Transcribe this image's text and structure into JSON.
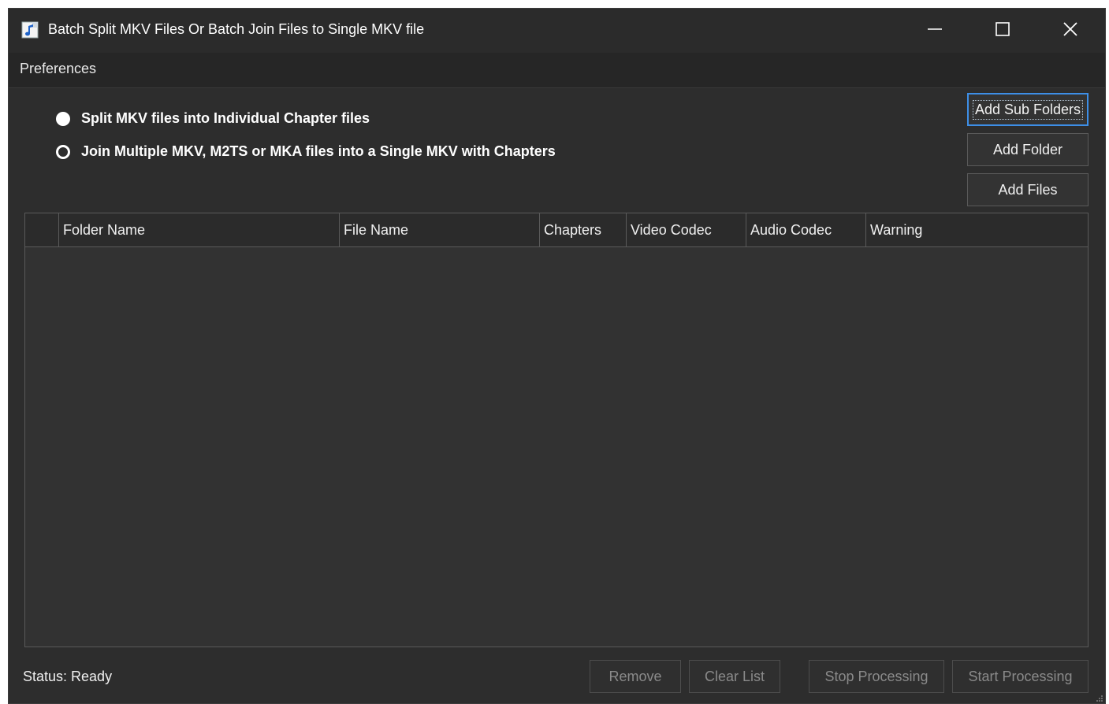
{
  "window": {
    "title": "Batch Split MKV Files Or Batch Join Files to Single MKV file",
    "app_icon": "music-note-icon",
    "controls": {
      "minimize_icon": "minimize-icon",
      "maximize_icon": "maximize-icon",
      "close_icon": "close-icon"
    }
  },
  "menubar": {
    "items": [
      {
        "label": "Preferences"
      }
    ]
  },
  "modes": {
    "split_label": "Split MKV files into Individual Chapter files",
    "join_label": "Join Multiple MKV, M2TS or MKA files into a Single MKV with Chapters",
    "selected": "split"
  },
  "side_buttons": {
    "add_sub_folders": "Add Sub Folders",
    "add_folder": "Add Folder",
    "add_files": "Add Files"
  },
  "file_list": {
    "columns": [
      "",
      "Folder Name",
      "File Name",
      "Chapters",
      "Video Codec",
      "Audio Codec",
      "Warning"
    ],
    "rows": []
  },
  "footer": {
    "status": "Status: Ready",
    "remove": "Remove",
    "clear_list": "Clear List",
    "stop_processing": "Stop Processing",
    "start_processing": "Start Processing"
  },
  "colors": {
    "background": "#2d2d2d",
    "titlebar": "#2b2b2b",
    "focus_border": "#3d8ee6",
    "text": "#ffffff",
    "disabled_text": "#8a8a8a"
  }
}
